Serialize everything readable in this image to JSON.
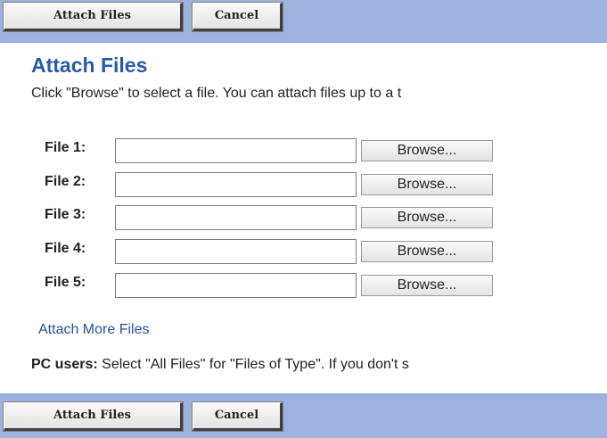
{
  "toolbar_top": {
    "attach_label": "Attach Files",
    "cancel_label": "Cancel"
  },
  "main": {
    "title": "Attach Files",
    "intro": "Click \"Browse\" to select a file. You can attach files up to a t",
    "files": [
      {
        "label": "File 1:",
        "value": "",
        "browse_label": "Browse..."
      },
      {
        "label": "File 2:",
        "value": "",
        "browse_label": "Browse..."
      },
      {
        "label": "File 3:",
        "value": "",
        "browse_label": "Browse..."
      },
      {
        "label": "File 4:",
        "value": "",
        "browse_label": "Browse..."
      },
      {
        "label": "File 5:",
        "value": "",
        "browse_label": "Browse..."
      }
    ],
    "attach_more_link": "Attach More Files",
    "pc_note_strong": "PC users:",
    "pc_note_text": " Select \"All Files\" for \"Files of Type\". If you don't s"
  },
  "toolbar_bottom": {
    "attach_label": "Attach Files",
    "cancel_label": "Cancel"
  },
  "colors": {
    "toolbar_bg": "#9db3dd",
    "title": "#2a5aa6",
    "link": "#2a4f9f"
  }
}
